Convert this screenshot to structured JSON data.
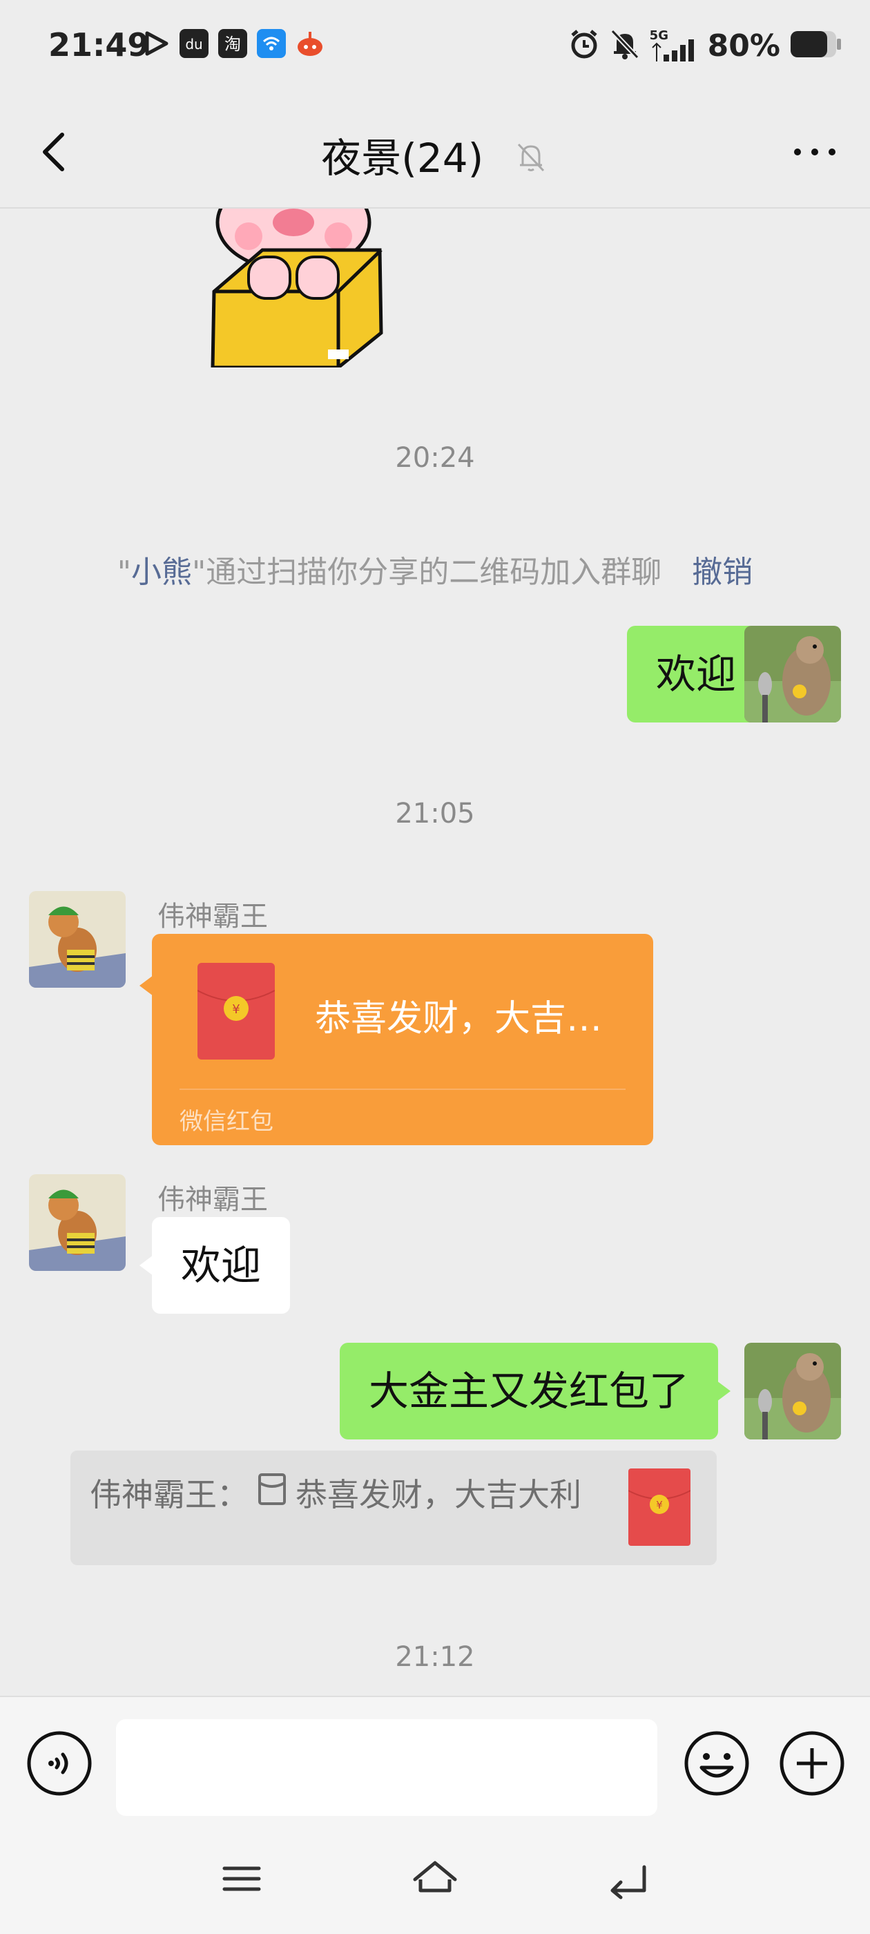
{
  "status_bar": {
    "time": "21:49",
    "network": "5G",
    "battery": "80%"
  },
  "header": {
    "title": "夜景(24)"
  },
  "messages": {
    "time_1": "20:24",
    "time_2": "21:05",
    "time_3": "21:12",
    "system_notice": {
      "quote_open": "\"",
      "name": "小熊",
      "quote_close": "\"",
      "text": "通过扫描你分享的二维码加入群聊",
      "action": "撤销"
    },
    "my_msg_1": "欢迎",
    "red_packet_sender": "伟神霸王",
    "red_packet_title": "恭喜发财，大吉…",
    "red_packet_label": "微信红包",
    "reply_sender": "伟神霸王",
    "reply_text": "欢迎",
    "my_msg_2": "大金主又发红包了",
    "quote": {
      "sender": "伟神霸王：",
      "text": "恭喜发财，大吉大利"
    }
  },
  "colors": {
    "bg": "#ededed",
    "green_bubble": "#95ec69",
    "red_packet": "#f99d3a",
    "link": "#576b95"
  }
}
